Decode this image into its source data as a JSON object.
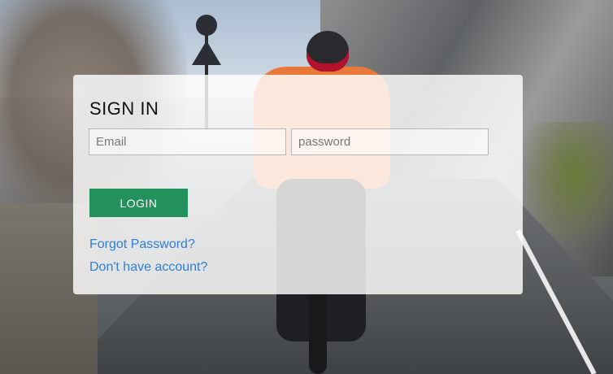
{
  "signin": {
    "title": "SIGN IN",
    "email_placeholder": "Email",
    "email_value": "",
    "password_placeholder": "password",
    "password_value": "",
    "login_label": "LOGIN",
    "forgot_link": "Forgot Password?",
    "register_link": "Don't have account?"
  },
  "colors": {
    "login_button": "#22915b",
    "link": "#2f7fd6",
    "card_background": "rgba(255,255,255,0.82)"
  },
  "background": {
    "description_icon": "cyclist-photo"
  }
}
